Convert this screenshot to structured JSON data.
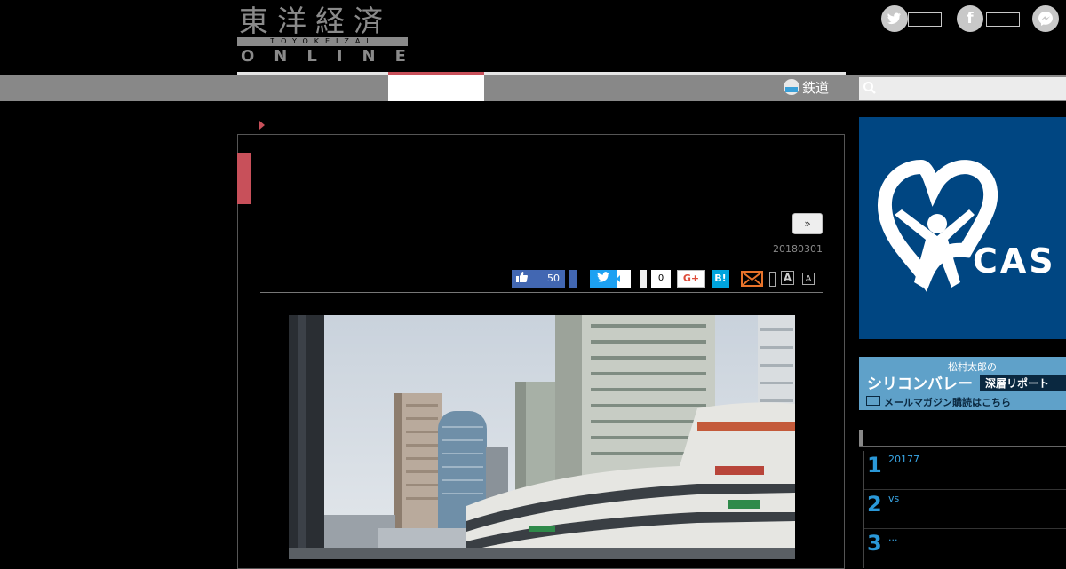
{
  "header": {
    "logo_kanji": "東洋経済",
    "logo_sub": "TOYOKEIZAI",
    "logo_online": "ONLINE",
    "social_icons": [
      "twitter-icon",
      "facebook-icon",
      "messenger-icon"
    ]
  },
  "nav": {
    "tetsudo_label": "鉄道",
    "search_placeholder": ""
  },
  "article": {
    "next_label": "»",
    "date": "20180301",
    "share": {
      "like_count": "50",
      "pocket_count": "0",
      "gplus_label": "G+",
      "hatena_label": "B!",
      "font_large": "A",
      "font_small": "A"
    }
  },
  "sidebar": {
    "ad_big_text": "CAS",
    "ad_small": {
      "line1": "松村太郎の",
      "line2": "シリコンバレー",
      "badge": "深層リポート",
      "line3": "メールマガジン購読はこちら"
    },
    "ranking": [
      {
        "num": "1",
        "text": "20177"
      },
      {
        "num": "2",
        "text": "vs"
      },
      {
        "num": "3",
        "text": "..."
      }
    ]
  },
  "colors": {
    "accent_red": "#c8505a",
    "nav_gray": "#888888",
    "ad_blue": "#004682",
    "rank_blue": "#2a98d8"
  }
}
